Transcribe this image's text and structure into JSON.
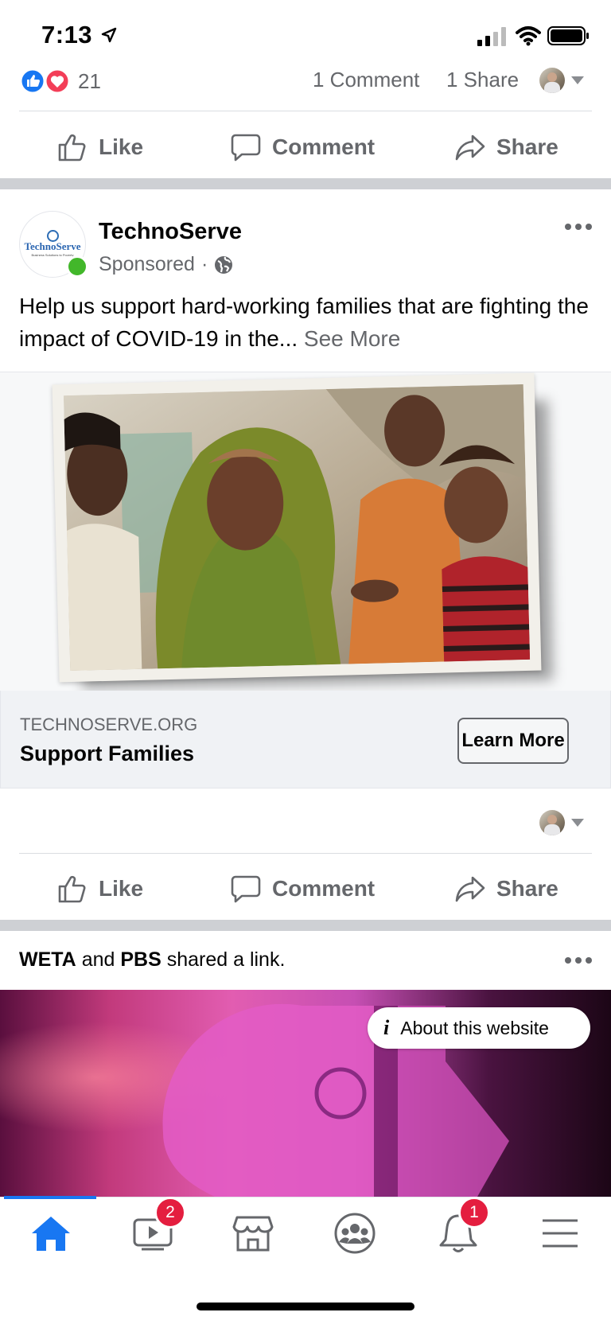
{
  "status_bar": {
    "time": "7:13"
  },
  "prev_post": {
    "reaction_count": "21",
    "comments": "1 Comment",
    "shares": "1 Share",
    "actions": {
      "like": "Like",
      "comment": "Comment",
      "share": "Share"
    }
  },
  "ad_post": {
    "page_name": "TechnoServe",
    "logo_text": "TechnoServe",
    "logo_tagline": "Business Solutions to Poverty",
    "sponsored": "Sponsored",
    "separator": "·",
    "text": "Help us support hard-working families that are fighting the impact of COVID-19 in the...",
    "see_more": "See More",
    "link_domain": "TECHNOSERVE.ORG",
    "link_title": "Support Families",
    "cta": "Learn More",
    "actions": {
      "like": "Like",
      "comment": "Comment",
      "share": "Share"
    }
  },
  "next_post": {
    "author1": "WETA",
    "conj": " and ",
    "author2": "PBS",
    "rest": " shared a link.",
    "about_website": "About this website"
  },
  "bottom_nav": {
    "items": [
      {
        "name": "home",
        "icon": "home-icon",
        "active": true
      },
      {
        "name": "watch",
        "icon": "video-icon",
        "badge": "2"
      },
      {
        "name": "marketplace",
        "icon": "shop-icon"
      },
      {
        "name": "groups",
        "icon": "groups-icon"
      },
      {
        "name": "notifications",
        "icon": "bell-icon",
        "badge": "1"
      },
      {
        "name": "menu",
        "icon": "menu-icon"
      }
    ]
  },
  "colors": {
    "accent": "#1877f2",
    "badge": "#e41e3f",
    "online": "#42b72a",
    "love": "#f33e58"
  }
}
